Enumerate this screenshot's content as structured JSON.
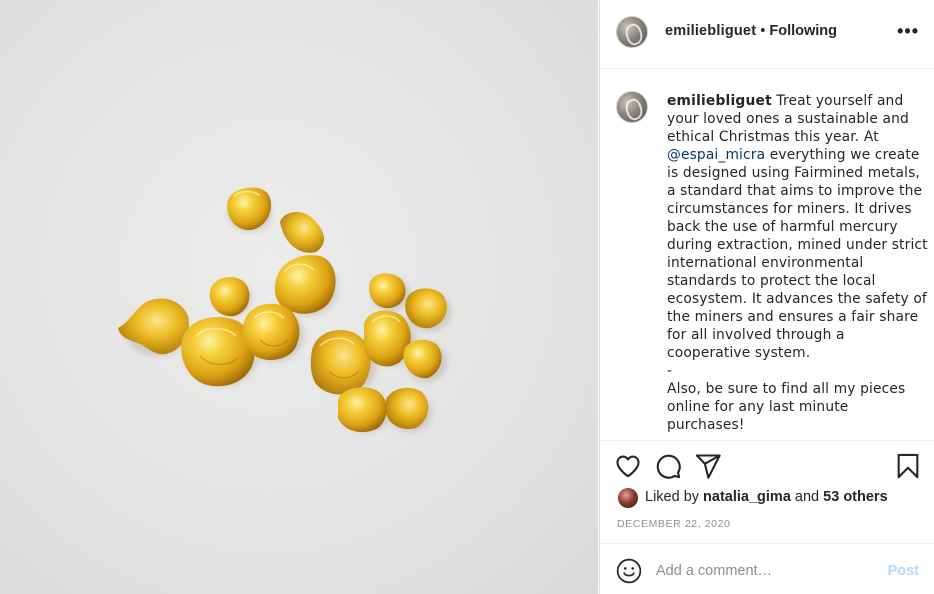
{
  "photo": {
    "alt_icon": "gold-nuggets-photo",
    "colors": {
      "gold_light": "#fbe07a",
      "gold_mid": "#e8b61c",
      "gold_dark": "#a7700a"
    }
  },
  "header": {
    "username": "emiliebliguet",
    "separator": "•",
    "follow_status": "Following",
    "more_label": "•••"
  },
  "caption": {
    "username": "emiliebliguet",
    "text_before_mention": "Treat yourself and your loved ones a sustainable and ethical Christmas this year. At",
    "mention": "@espai_micra",
    "text_after_mention": "everything we create is designed using Fairmined metals, a standard that aims to improve the circumstances for miners. It drives back the use of harmful mercury during extraction, mined under strict international environmental standards to protect the local ecosystem. It advances the safety of the miners and ensures a fair share for all involved through a cooperative system.",
    "dash": "-",
    "text_end": "Also, be sure to find all my pieces online for any last minute purchases!"
  },
  "actions": {
    "icons": [
      "heart-icon",
      "comment-icon",
      "share-icon",
      "bookmark-icon"
    ]
  },
  "likes": {
    "prefix": "Liked by",
    "user": "natalia_gima",
    "conj": "and",
    "others": "53 others"
  },
  "date": "DECEMBER 22, 2020",
  "comment": {
    "placeholder": "Add a comment…",
    "post_label": "Post"
  },
  "colors": {
    "text": "#262626",
    "secondary": "#8e8e8e",
    "mention": "#00376b",
    "post_disabled": "#b3dbff",
    "divider": "#efefef"
  }
}
